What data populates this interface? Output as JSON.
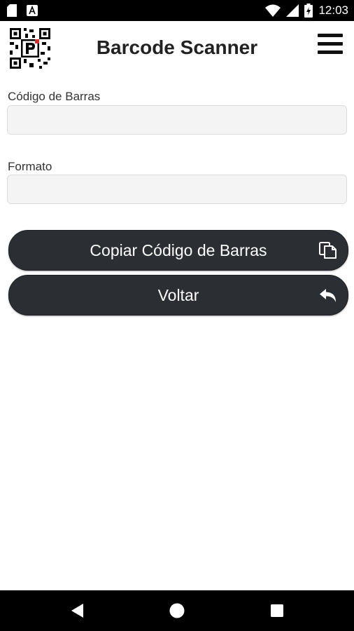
{
  "status_bar": {
    "time": "12:03",
    "left_icons": [
      "sd-card-icon",
      "notification-a-icon"
    ],
    "right_icons": [
      "wifi-icon",
      "cellular-signal-icon",
      "battery-icon"
    ]
  },
  "header": {
    "title": "Barcode Scanner",
    "logo_icon": "qr-code-logo-icon",
    "menu_icon": "hamburger-menu-icon"
  },
  "form": {
    "barcode_label": "Código de Barras",
    "barcode_value": "",
    "format_label": "Formato",
    "format_value": ""
  },
  "buttons": {
    "copy_label": "Copiar Código de Barras",
    "copy_icon": "copy-icon",
    "back_label": "Voltar",
    "back_icon": "reply-arrow-icon"
  },
  "nav_bar": {
    "back_icon": "nav-back-icon",
    "home_icon": "nav-home-icon",
    "recents_icon": "nav-recents-icon"
  },
  "colors": {
    "button_background": "#2b2f33",
    "status_bar": "#000000",
    "input_background": "#f4f4f4"
  }
}
